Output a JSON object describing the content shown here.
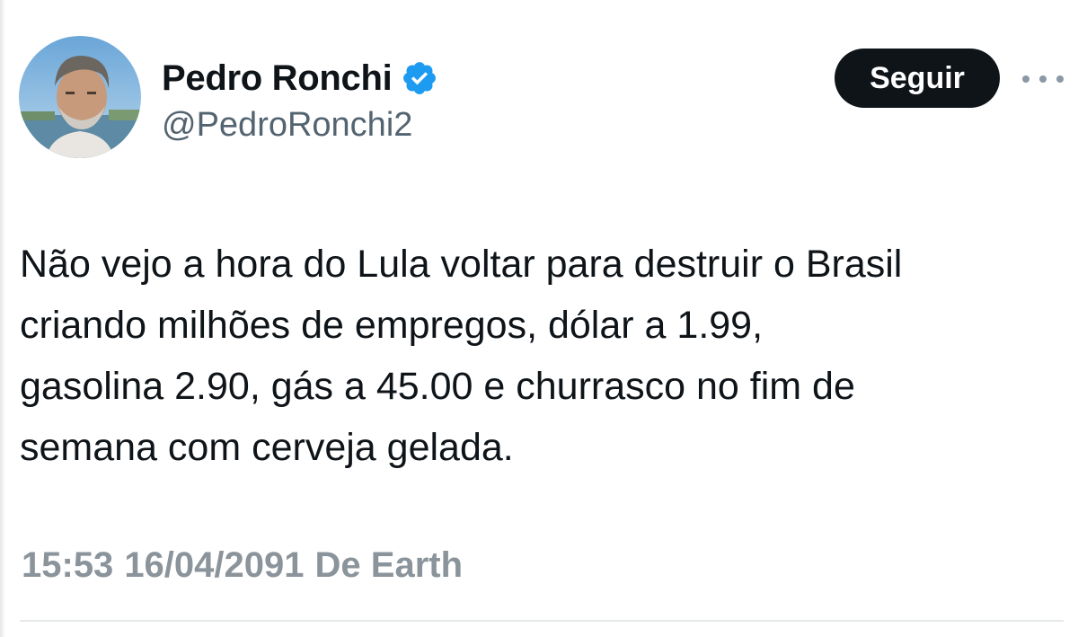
{
  "author": {
    "display_name": "Pedro Ronchi",
    "handle": "@PedroRonchi2",
    "verified": true,
    "verified_color": "#1d9bf0"
  },
  "actions": {
    "follow_label": "Seguir",
    "more_icon": "more-horizontal-icon"
  },
  "tweet": {
    "lines": [
      "Não vejo a hora do Lula voltar para destruir o Brasil",
      "criando milhões de empregos, dólar a 1.99,",
      "gasolina 2.90, gás a 45.00 e churrasco no fim de",
      "semana com cerveja gelada."
    ]
  },
  "meta": {
    "time": "15:53",
    "date": "16/04/2091",
    "source": "De Earth"
  },
  "colors": {
    "text": "#0f1419",
    "secondary": "#536471",
    "button_bg": "#0f1419",
    "meta": "#8b949b"
  }
}
